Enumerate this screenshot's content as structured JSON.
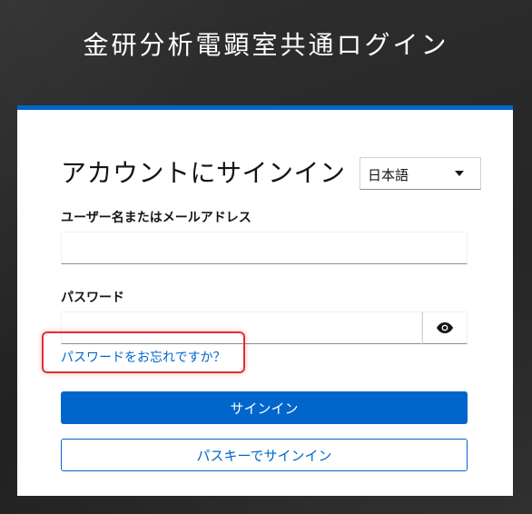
{
  "page": {
    "title": "金研分析電顕室共通ログイン"
  },
  "login": {
    "heading": "アカウントにサインイン",
    "language": {
      "selected": "日本語"
    },
    "username": {
      "label": "ユーザー名またはメールアドレス",
      "value": "",
      "placeholder": ""
    },
    "password": {
      "label": "パスワード",
      "value": "",
      "placeholder": ""
    },
    "forgot_password": "パスワードをお忘れですか？",
    "sign_in_button": "サインイン",
    "passkey_button": "パスキーでサインイン"
  },
  "colors": {
    "accent": "#0066cc",
    "highlight": "#e03131",
    "background": "#2b2b2b"
  },
  "icons": {
    "password_toggle": "eye-icon",
    "language_dropdown": "chevron-down-icon"
  }
}
